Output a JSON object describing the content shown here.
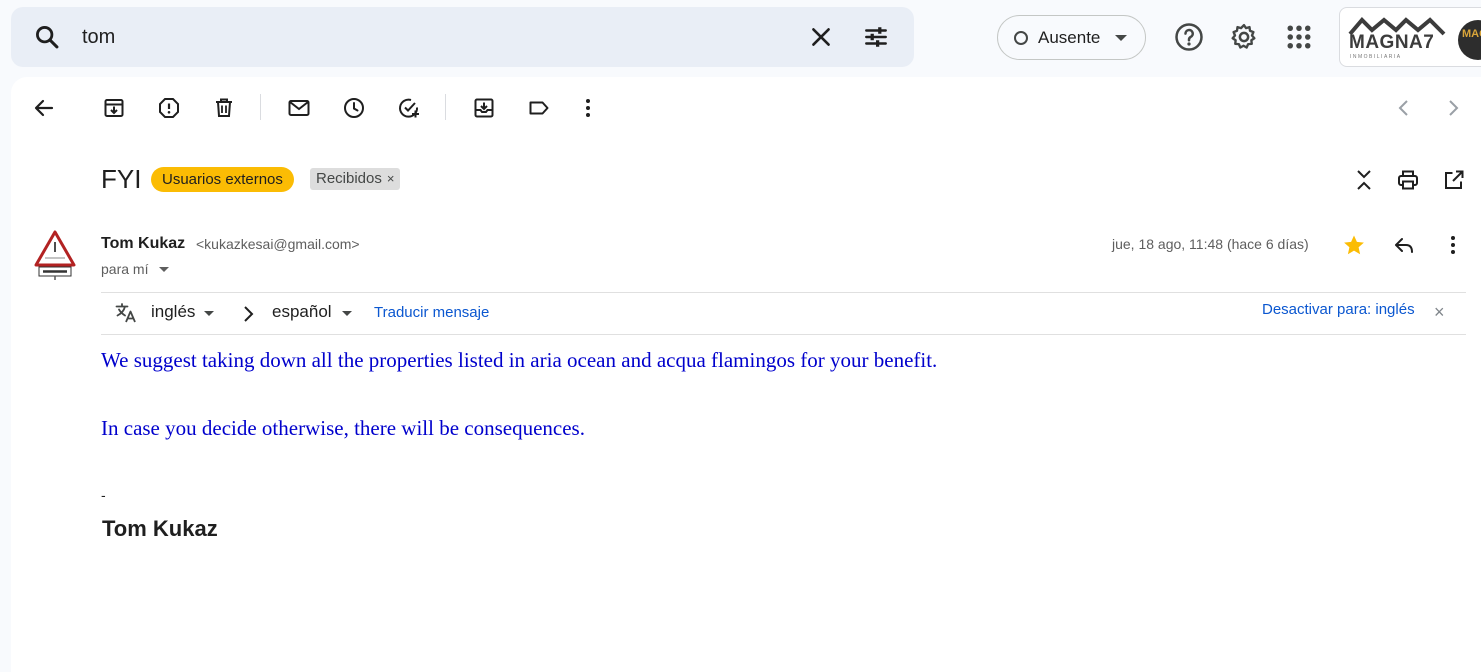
{
  "search": {
    "query": "tom",
    "icon": "search-icon",
    "clear_icon": "close-icon",
    "options_icon": "tune-icon"
  },
  "status": {
    "label": "Ausente"
  },
  "brand": {
    "logo_text": "MAGNA7",
    "logo_sub": "INMOBILIARIA",
    "avatar_text": "MAGNA"
  },
  "toolbar": {
    "icons": [
      "back-arrow-icon",
      "archive-icon",
      "report-spam-icon",
      "delete-icon",
      "mark-unread-icon",
      "snooze-icon",
      "add-to-tasks-icon",
      "move-to-icon",
      "label-icon",
      "more-vert-icon",
      "older-icon",
      "newer-icon"
    ]
  },
  "email": {
    "subject": "FYI",
    "labels": {
      "external": "Usuarios externos",
      "inbox": "Recibidos",
      "inbox_remove": "×"
    },
    "sender_name": "Tom Kukaz",
    "sender_email": "<kukazkesai@gmail.com>",
    "to_label": "para mí",
    "date": "jue, 18 ago, 11:48 (hace 6 días)",
    "starred": true,
    "translate": {
      "from": "inglés",
      "to": "español",
      "translate_link": "Traducir mensaje",
      "disable_link": "Desactivar para: inglés",
      "close": "×"
    },
    "body": [
      "We suggest taking down all the properties listed in aria ocean and acqua flamingos for your benefit.",
      "In case you decide otherwise, there will be consequences."
    ],
    "signature_dash": "-",
    "signature_name": "Tom Kukaz"
  },
  "colors": {
    "accent_label": "#fbbc04",
    "body_text": "#0000cc",
    "link": "#0b57d0",
    "star": "#fbbc04"
  }
}
